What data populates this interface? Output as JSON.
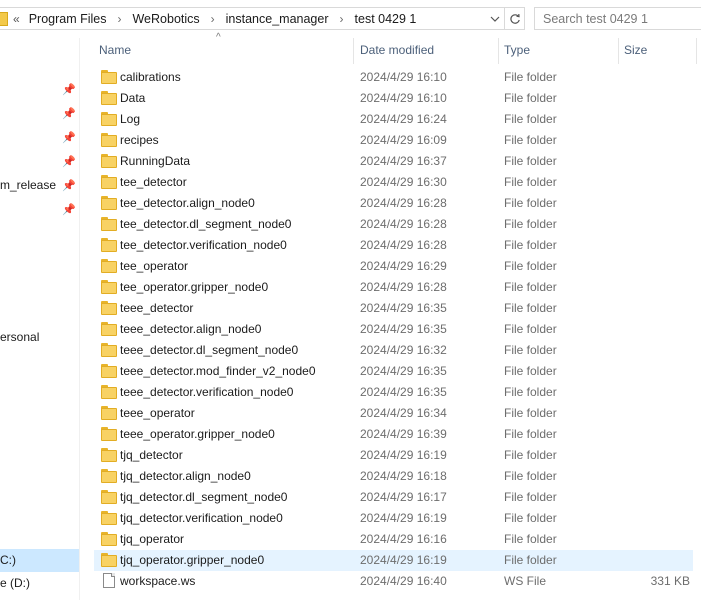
{
  "address_bar": {
    "overflow": "«",
    "crumbs": [
      "Program Files",
      "WeRobotics",
      "instance_manager",
      "test 0429 1"
    ]
  },
  "search": {
    "placeholder": "Search test 0429 1"
  },
  "nav": {
    "items": [
      "m_release",
      "ersonal"
    ],
    "drives": [
      "C:)",
      "e (D:)"
    ]
  },
  "columns": {
    "name": "Name",
    "date": "Date modified",
    "type": "Type",
    "size": "Size"
  },
  "files": [
    {
      "name": "calibrations",
      "date": "2024/4/29 16:10",
      "type": "File folder",
      "size": "",
      "icon": "folder-icon"
    },
    {
      "name": "Data",
      "date": "2024/4/29 16:10",
      "type": "File folder",
      "size": "",
      "icon": "folder-icon"
    },
    {
      "name": "Log",
      "date": "2024/4/29 16:24",
      "type": "File folder",
      "size": "",
      "icon": "folder-icon"
    },
    {
      "name": "recipes",
      "date": "2024/4/29 16:09",
      "type": "File folder",
      "size": "",
      "icon": "folder-icon"
    },
    {
      "name": "RunningData",
      "date": "2024/4/29 16:37",
      "type": "File folder",
      "size": "",
      "icon": "folder-icon"
    },
    {
      "name": "tee_detector",
      "date": "2024/4/29 16:30",
      "type": "File folder",
      "size": "",
      "icon": "folder-icon"
    },
    {
      "name": "tee_detector.align_node0",
      "date": "2024/4/29 16:28",
      "type": "File folder",
      "size": "",
      "icon": "folder-icon"
    },
    {
      "name": "tee_detector.dl_segment_node0",
      "date": "2024/4/29 16:28",
      "type": "File folder",
      "size": "",
      "icon": "folder-icon"
    },
    {
      "name": "tee_detector.verification_node0",
      "date": "2024/4/29 16:28",
      "type": "File folder",
      "size": "",
      "icon": "folder-icon"
    },
    {
      "name": "tee_operator",
      "date": "2024/4/29 16:29",
      "type": "File folder",
      "size": "",
      "icon": "folder-icon"
    },
    {
      "name": "tee_operator.gripper_node0",
      "date": "2024/4/29 16:28",
      "type": "File folder",
      "size": "",
      "icon": "folder-icon"
    },
    {
      "name": "teee_detector",
      "date": "2024/4/29 16:35",
      "type": "File folder",
      "size": "",
      "icon": "folder-icon"
    },
    {
      "name": "teee_detector.align_node0",
      "date": "2024/4/29 16:35",
      "type": "File folder",
      "size": "",
      "icon": "folder-icon"
    },
    {
      "name": "teee_detector.dl_segment_node0",
      "date": "2024/4/29 16:32",
      "type": "File folder",
      "size": "",
      "icon": "folder-icon"
    },
    {
      "name": "teee_detector.mod_finder_v2_node0",
      "date": "2024/4/29 16:35",
      "type": "File folder",
      "size": "",
      "icon": "folder-icon"
    },
    {
      "name": "teee_detector.verification_node0",
      "date": "2024/4/29 16:35",
      "type": "File folder",
      "size": "",
      "icon": "folder-icon"
    },
    {
      "name": "teee_operator",
      "date": "2024/4/29 16:34",
      "type": "File folder",
      "size": "",
      "icon": "folder-icon"
    },
    {
      "name": "teee_operator.gripper_node0",
      "date": "2024/4/29 16:39",
      "type": "File folder",
      "size": "",
      "icon": "folder-icon"
    },
    {
      "name": "tjq_detector",
      "date": "2024/4/29 16:19",
      "type": "File folder",
      "size": "",
      "icon": "folder-icon"
    },
    {
      "name": "tjq_detector.align_node0",
      "date": "2024/4/29 16:18",
      "type": "File folder",
      "size": "",
      "icon": "folder-icon"
    },
    {
      "name": "tjq_detector.dl_segment_node0",
      "date": "2024/4/29 16:17",
      "type": "File folder",
      "size": "",
      "icon": "folder-icon"
    },
    {
      "name": "tjq_detector.verification_node0",
      "date": "2024/4/29 16:19",
      "type": "File folder",
      "size": "",
      "icon": "folder-icon"
    },
    {
      "name": "tjq_operator",
      "date": "2024/4/29 16:16",
      "type": "File folder",
      "size": "",
      "icon": "folder-icon"
    },
    {
      "name": "tjq_operator.gripper_node0",
      "date": "2024/4/29 16:19",
      "type": "File folder",
      "size": "",
      "icon": "folder-icon",
      "selected": true
    },
    {
      "name": "workspace.ws",
      "date": "2024/4/29 16:40",
      "type": "WS File",
      "size": "331 KB",
      "icon": "file-icon"
    }
  ],
  "colors": {
    "folder": "#f8d264",
    "selected_row": "#e5f3ff",
    "selected_drive": "#cce8ff",
    "header_text": "#4c607a"
  }
}
